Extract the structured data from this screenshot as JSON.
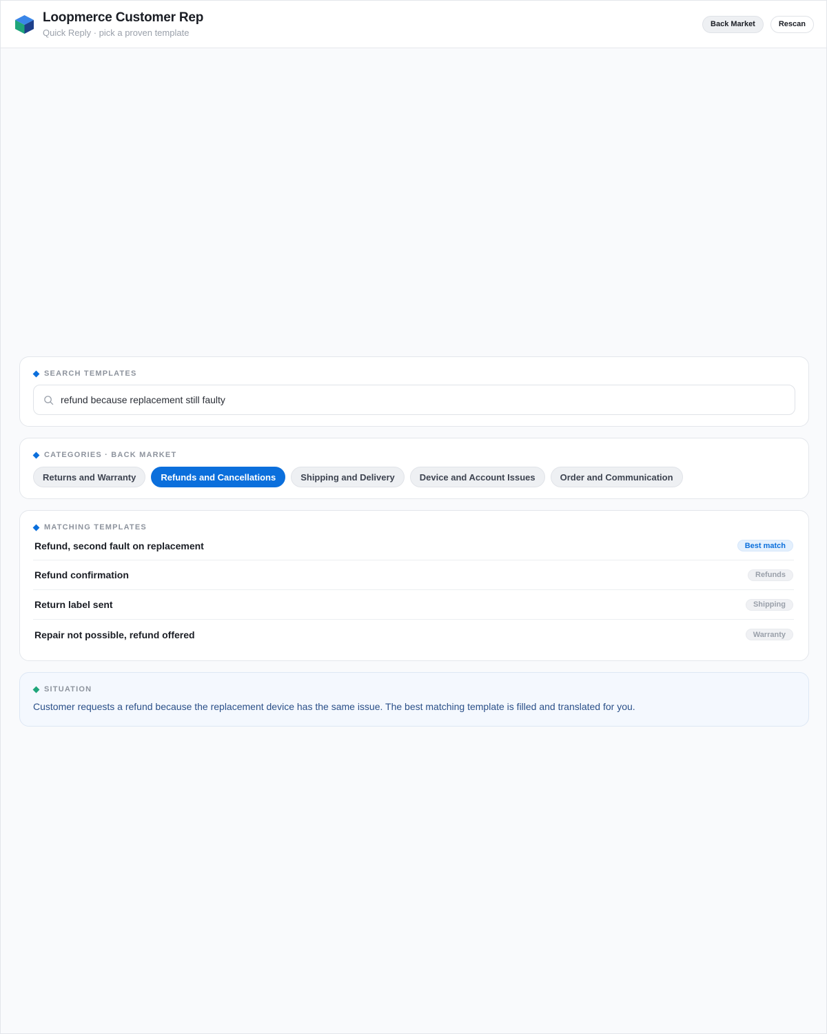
{
  "header": {
    "app_title": "Loopmerce Customer Rep",
    "app_subtitle": "Quick Reply · pick a proven template",
    "market_button": "Back Market",
    "rescan_button": "Rescan"
  },
  "search": {
    "label": "SEARCH TEMPLATES",
    "value": "refund because replacement still faulty"
  },
  "categories": {
    "label": "CATEGORIES · BACK MARKET",
    "items": [
      {
        "label": "Returns and Warranty",
        "active": false
      },
      {
        "label": "Refunds and Cancellations",
        "active": true
      },
      {
        "label": "Shipping and Delivery",
        "active": false
      },
      {
        "label": "Device and Account Issues",
        "active": false
      },
      {
        "label": "Order and Communication",
        "active": false
      }
    ]
  },
  "templates": {
    "label": "MATCHING TEMPLATES",
    "items": [
      {
        "title": "Refund, second fault on replacement",
        "tag": "Best match"
      },
      {
        "title": "Refund confirmation",
        "tag": "Refunds"
      },
      {
        "title": "Return label sent",
        "tag": "Shipping"
      },
      {
        "title": "Repair not possible, refund offered",
        "tag": "Warranty"
      }
    ]
  },
  "situation": {
    "label": "SITUATION",
    "text": "Customer requests a refund because the replacement device has the same issue. The best matching template is filled and translated for you."
  },
  "colors": {
    "accent": "#0b6fdc",
    "situation_accent": "#1fa57a",
    "situation_text": "#2a4f88"
  },
  "icons": {
    "logo": "cube-logo-icon",
    "search": "search-icon"
  }
}
